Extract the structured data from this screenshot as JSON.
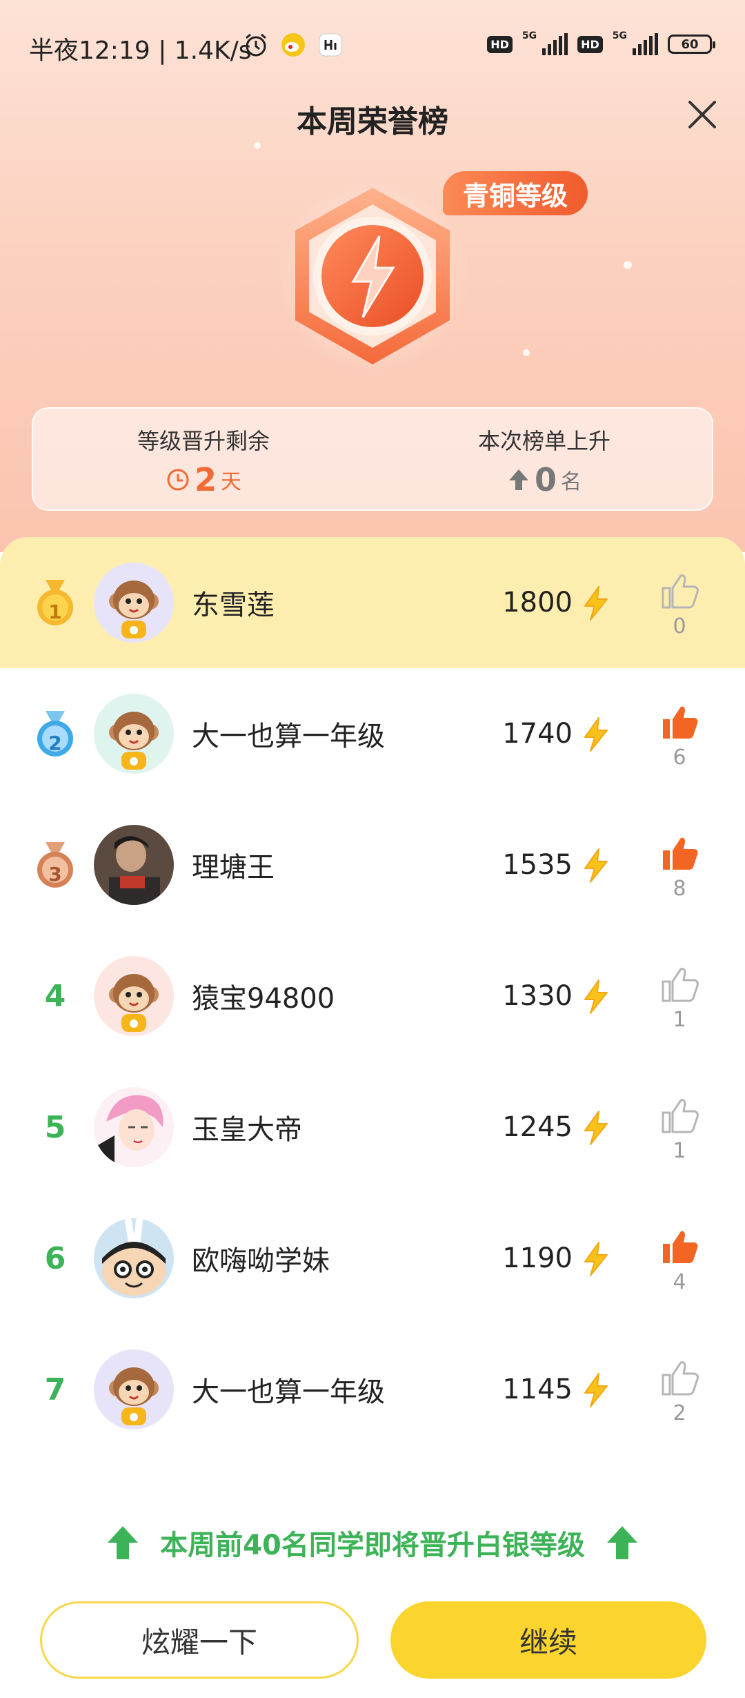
{
  "status_bar": {
    "time": "半夜12:19 | 1.4K/s",
    "network_5g": "5G",
    "hd": "HD",
    "battery": "60",
    "icons": [
      "alarm-icon",
      "weibo-icon",
      "app-icon",
      "signal-icon",
      "battery-icon"
    ]
  },
  "header": {
    "title": "本周荣誉榜"
  },
  "badge": {
    "level_label": "青铜等级"
  },
  "stats": {
    "left_label": "等级晋升剩余",
    "left_value": "2",
    "left_unit": "天",
    "right_label": "本次榜单上升",
    "right_value": "0",
    "right_unit": "名"
  },
  "ranking": [
    {
      "rank": "1",
      "name": "东雪莲",
      "score": "1800",
      "likes": "0",
      "liked": false,
      "medal": "gold"
    },
    {
      "rank": "2",
      "name": "大一也算一年级",
      "score": "1740",
      "likes": "6",
      "liked": true,
      "medal": "silver"
    },
    {
      "rank": "3",
      "name": "理塘王",
      "score": "1535",
      "likes": "8",
      "liked": true,
      "medal": "bronze"
    },
    {
      "rank": "4",
      "name": "猿宝94800",
      "score": "1330",
      "likes": "1",
      "liked": false
    },
    {
      "rank": "5",
      "name": "玉皇大帝",
      "score": "1245",
      "likes": "1",
      "liked": false
    },
    {
      "rank": "6",
      "name": "欧嗨呦学妹",
      "score": "1190",
      "likes": "4",
      "liked": true
    },
    {
      "rank": "7",
      "name": "大一也算一年级",
      "score": "1145",
      "likes": "2",
      "liked": false
    }
  ],
  "promo": {
    "text": "本周前40名同学即将晋升白银等级"
  },
  "buttons": {
    "show_off": "炫耀一下",
    "continue": "继续"
  },
  "colors": {
    "accent_green": "#3db357",
    "accent_yellow": "#fbd52e",
    "accent_orange": "#f26a35",
    "liked_orange": "#f26522"
  }
}
